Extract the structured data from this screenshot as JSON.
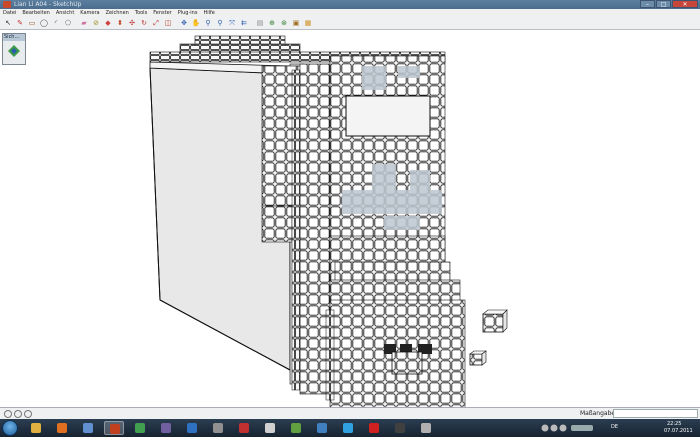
{
  "window": {
    "title": "Lian Li A04 - SketchUp",
    "controls": [
      "–",
      "□",
      "✕"
    ]
  },
  "menubar": {
    "items": [
      "Datei",
      "Bearbeiten",
      "Ansicht",
      "Kamera",
      "Zeichnen",
      "Tools",
      "Fenster",
      "Plug-ins",
      "Hilfe"
    ]
  },
  "toolbar": {
    "tools": [
      {
        "icon": "select-arrow-icon",
        "glyph": "↖",
        "color": "#333333"
      },
      {
        "icon": "pencil-icon",
        "glyph": "✎",
        "color": "#c03030"
      },
      {
        "icon": "rectangle-icon",
        "glyph": "▭",
        "color": "#8a5a2a"
      },
      {
        "icon": "circle-icon",
        "glyph": "◯",
        "color": "#444444"
      },
      {
        "icon": "arc-icon",
        "glyph": "◜",
        "color": "#444444"
      },
      {
        "icon": "polygon-icon",
        "glyph": "⬠",
        "color": "#666666"
      },
      {
        "icon": "eraser-icon",
        "glyph": "▰",
        "color": "#d070a0"
      },
      {
        "icon": "tape-measure-icon",
        "glyph": "⊘",
        "color": "#a09020"
      },
      {
        "icon": "paint-bucket-icon",
        "glyph": "◆",
        "color": "#d04040"
      },
      {
        "icon": "push-pull-icon",
        "glyph": "⬍",
        "color": "#c04020"
      },
      {
        "icon": "move-icon",
        "glyph": "✣",
        "color": "#c03030"
      },
      {
        "icon": "rotate-icon",
        "glyph": "↻",
        "color": "#c03030"
      },
      {
        "icon": "scale-icon",
        "glyph": "⤢",
        "color": "#c03030"
      },
      {
        "icon": "offset-icon",
        "glyph": "◫",
        "color": "#c04020"
      },
      {
        "icon": "orbit-icon",
        "glyph": "✥",
        "color": "#3060b0"
      },
      {
        "icon": "pan-icon",
        "glyph": "✋",
        "color": "#3060b0"
      },
      {
        "icon": "zoom-icon",
        "glyph": "⚲",
        "color": "#3060b0"
      },
      {
        "icon": "zoom-window-icon",
        "glyph": "⚲",
        "color": "#3060b0"
      },
      {
        "icon": "zoom-extents-icon",
        "glyph": "⤧",
        "color": "#3060b0"
      },
      {
        "icon": "previous-view-icon",
        "glyph": "⇇",
        "color": "#3060b0"
      },
      {
        "icon": "get-models-icon",
        "glyph": "▤",
        "color": "#888888"
      },
      {
        "icon": "share-model-icon",
        "glyph": "⊕",
        "color": "#308030"
      },
      {
        "icon": "share-component-icon",
        "glyph": "⊛",
        "color": "#308030"
      },
      {
        "icon": "warehouse-icon",
        "glyph": "▣",
        "color": "#a07020"
      },
      {
        "icon": "components-icon",
        "glyph": "▦",
        "color": "#d09020"
      }
    ]
  },
  "mini_toolbar": {
    "title": "Sich...",
    "icon": "axes-orbit-icon"
  },
  "statusbar": {
    "measure_label": "Maßangaben",
    "measure_value": "",
    "icons": [
      "geo-location-icon",
      "credits-icon",
      "help-icon"
    ]
  },
  "taskbar": {
    "apps": [
      {
        "icon": "explorer-icon",
        "color": "#e0b040"
      },
      {
        "icon": "firefox-icon",
        "color": "#e07020"
      },
      {
        "icon": "itunes-icon",
        "color": "#6090d0"
      },
      {
        "icon": "sketchup-icon",
        "color": "#c04020",
        "active": true
      },
      {
        "icon": "app-green-icon",
        "color": "#40a050"
      },
      {
        "icon": "app-purple-icon",
        "color": "#7060a0"
      },
      {
        "icon": "app-blue-icon",
        "color": "#3070c0"
      },
      {
        "icon": "app-gray-icon",
        "color": "#909090"
      },
      {
        "icon": "filezilla-icon",
        "color": "#c03030"
      },
      {
        "icon": "notepad-icon",
        "color": "#d0d0d0"
      },
      {
        "icon": "app-cube-icon",
        "color": "#60a040"
      },
      {
        "icon": "app-globe-icon",
        "color": "#4080c0"
      },
      {
        "icon": "skype-icon",
        "color": "#30a0e0"
      },
      {
        "icon": "opera-icon",
        "color": "#d02020"
      },
      {
        "icon": "app-black-icon",
        "color": "#404040"
      },
      {
        "icon": "app-tools-icon",
        "color": "#b0b0b0"
      }
    ],
    "language": "DE",
    "time": "22:25",
    "date": "07.07.2011"
  }
}
